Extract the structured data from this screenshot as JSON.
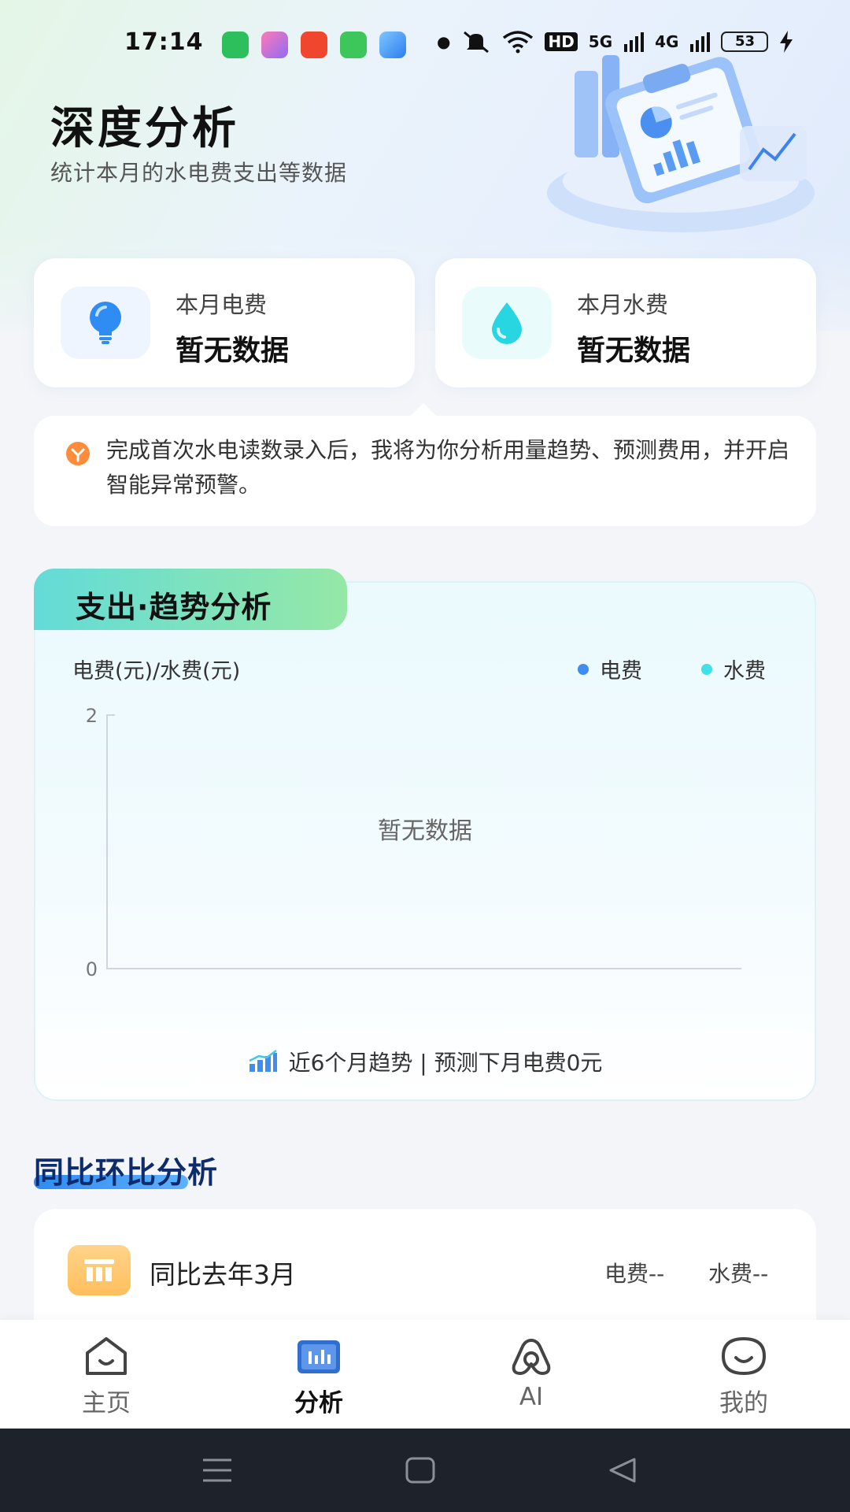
{
  "status_bar": {
    "time": "17:14",
    "network_5g": "5G",
    "network_4g": "4G",
    "hd": "HD",
    "battery": "53"
  },
  "header": {
    "title": "深度分析",
    "subtitle": "统计本月的水电费支出等数据"
  },
  "cards": {
    "electric": {
      "label": "本月电费",
      "value": "暂无数据",
      "icon": "lightbulb-icon"
    },
    "water": {
      "label": "本月水费",
      "value": "暂无数据",
      "icon": "water-drop-icon"
    }
  },
  "tip": {
    "text": "完成首次水电读数录入后，我将为你分析用量趋势、预测费用，并开启智能异常预警。"
  },
  "chart_section": {
    "tag": "支出·趋势分析",
    "ylabel": "电费(元)/水费(元)",
    "legend_elec": "电费",
    "legend_water": "水费",
    "empty_text": "暂无数据",
    "footer": "近6个月趋势 | 预测下月电费0元",
    "colors": {
      "elec": "#3d8ef0",
      "water": "#3fe0e8"
    }
  },
  "chart_data": {
    "type": "line",
    "title": "",
    "ylabel": "电费(元)/水费(元)",
    "xlabel": "",
    "ylim": [
      0,
      2
    ],
    "yticks": [
      "0",
      "2"
    ],
    "series": [
      {
        "name": "电费",
        "values": []
      },
      {
        "name": "水费",
        "values": []
      }
    ],
    "empty_text": "暂无数据",
    "legend": "top-right",
    "grid": false
  },
  "yoy_section": {
    "title": "同比环比分析",
    "row_label": "同比去年3月",
    "elec": "电费--",
    "water": "水费--"
  },
  "tabbar": {
    "home": "主页",
    "analysis": "分析",
    "ai": "AI",
    "mine": "我的"
  }
}
